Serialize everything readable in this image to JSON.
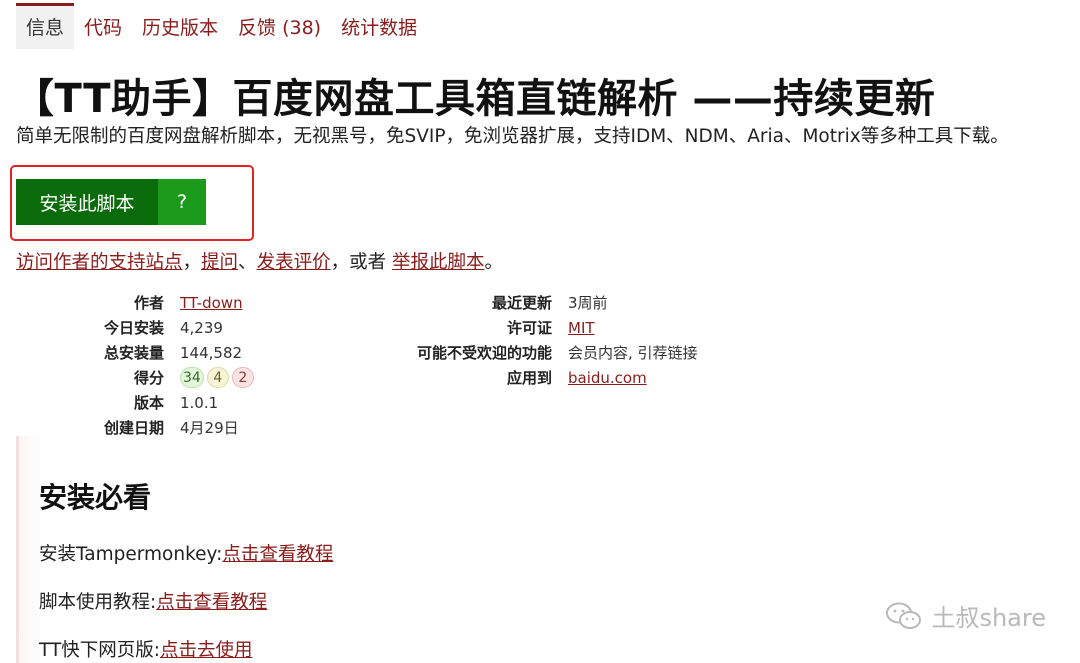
{
  "tabs": [
    "信息",
    "代码",
    "历史版本",
    "反馈 (38)",
    "统计数据"
  ],
  "title": "【TT助手】百度网盘工具箱直链解析 ——持续更新",
  "description": "简单无限制的百度网盘解析脚本，无视黑号，免SVIP，免浏览器扩展，支持IDM、NDM、Aria、Motrix等多种工具下载。",
  "install": {
    "label": "安装此脚本",
    "help": "?"
  },
  "links": {
    "support": "访问作者的支持站点",
    "sep1": "，",
    "ask": "提问",
    "sep2": "、",
    "review": "发表评价",
    "sep3": "，或者 ",
    "report": "举报此脚本",
    "end": "。"
  },
  "info_left": {
    "author_label": "作者",
    "author": "TT-down",
    "daily_label": "今日安装",
    "daily": "4,239",
    "total_label": "总安装量",
    "total": "144,582",
    "rating_label": "得分",
    "rating_good": "34",
    "rating_ok": "4",
    "rating_bad": "2",
    "version_label": "版本",
    "version": "1.0.1",
    "created_label": "创建日期",
    "created": "4月29日"
  },
  "info_right": {
    "updated_label": "最近更新",
    "updated": "3周前",
    "license_label": "许可证",
    "license": "MIT",
    "antifeature_label": "可能不受欢迎的功能",
    "antifeature": "会员内容, 引荐链接",
    "applies_label": "应用到",
    "applies": "baidu.com"
  },
  "guide": {
    "heading": "安装必看",
    "items": [
      {
        "text": "安装Tampermonkey:",
        "link": "点击查看教程"
      },
      {
        "text": "脚本使用教程:",
        "link": "点击查看教程"
      },
      {
        "text": "TT快下网页版:",
        "link": "点击去使用"
      }
    ]
  },
  "watermark": "土叔share",
  "colors": {
    "link": "#8a1c1c",
    "install": "#0a6b0a",
    "install_help": "#1c9a1c",
    "highlight": "#e02424"
  }
}
